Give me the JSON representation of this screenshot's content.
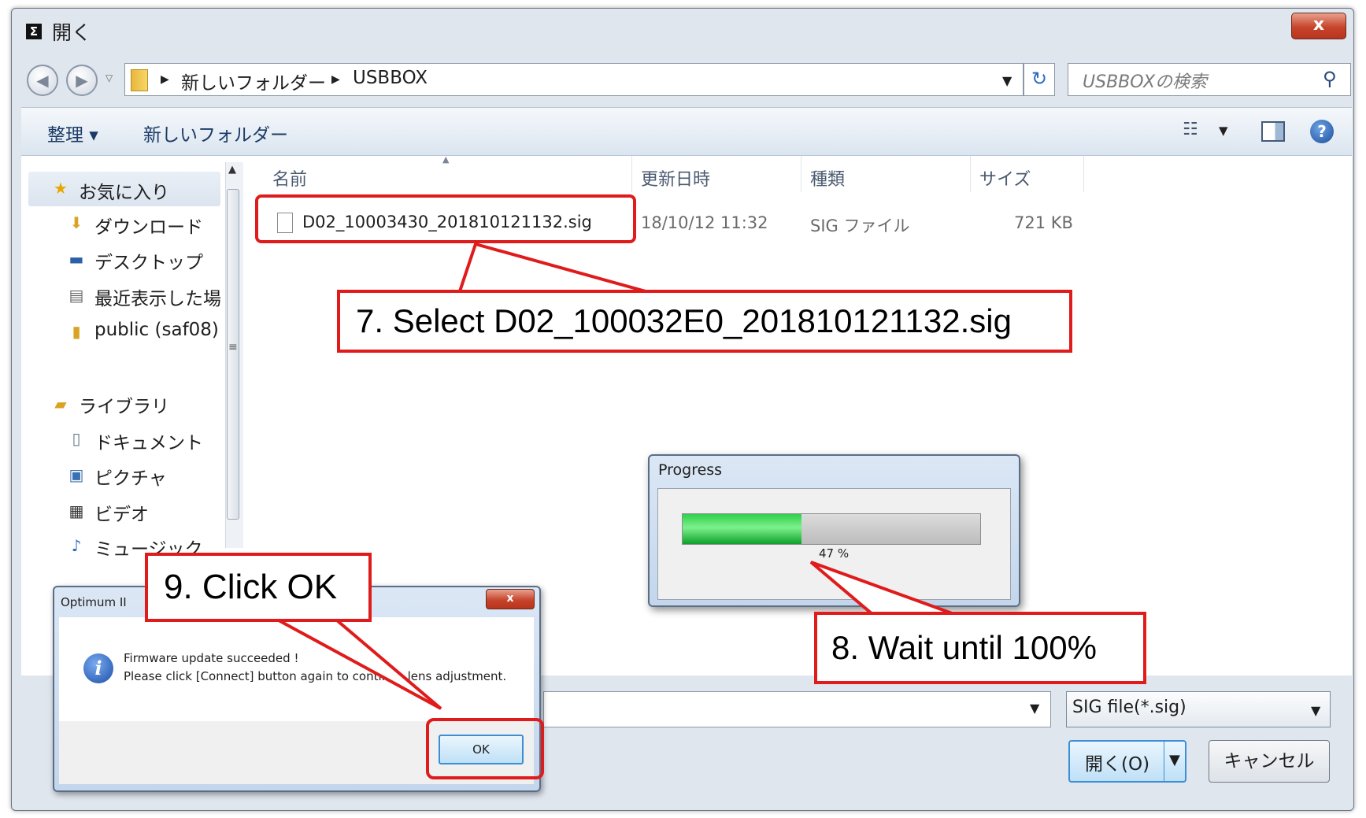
{
  "window": {
    "title": "開く",
    "close_label": "x"
  },
  "address": {
    "crumbs": [
      "新しいフォルダー",
      "USBBOX"
    ],
    "search_placeholder": "USBBOXの検索"
  },
  "toolbar": {
    "organize_label": "整理 ▾",
    "new_folder_label": "新しいフォルダー"
  },
  "sidebar": {
    "items": [
      {
        "label": "お気に入り",
        "icon": "star-icon"
      },
      {
        "label": "ダウンロード",
        "icon": "downloads-icon"
      },
      {
        "label": "デスクトップ",
        "icon": "desktop-icon"
      },
      {
        "label": "最近表示した場所",
        "icon": "recent-places-icon"
      },
      {
        "label": "public (saf08)",
        "icon": "network-folder-icon"
      },
      {
        "label": "ライブラリ",
        "icon": "library-icon"
      },
      {
        "label": "ドキュメント",
        "icon": "documents-icon"
      },
      {
        "label": "ピクチャ",
        "icon": "pictures-icon"
      },
      {
        "label": "ビデオ",
        "icon": "videos-icon"
      },
      {
        "label": "ミュージック",
        "icon": "music-icon"
      }
    ]
  },
  "file_list": {
    "columns": [
      "名前",
      "更新日時",
      "種類",
      "サイズ"
    ],
    "rows": [
      {
        "name": "D02_10003430_201810121132.sig",
        "date": "18/10/12 11:32",
        "type": "SIG ファイル",
        "size": "721 KB"
      }
    ]
  },
  "footer": {
    "filename_value": "",
    "filetype_value": "SIG file(*.sig)",
    "open_label": "開く(O)",
    "cancel_label": "キャンセル"
  },
  "progress": {
    "title": "Progress",
    "percent_label": "47 %",
    "fraction": 0.4
  },
  "message_box": {
    "title": "Optimum II",
    "line1": "Firmware update succeeded !",
    "line2": "Please click [Connect] button again to continue lens adjustment.",
    "ok_label": "OK",
    "close_label": "x"
  },
  "annotations": {
    "step7": "7. Select D02_100032E0_201810121132.sig",
    "step8": "8. Wait until 100%",
    "step9": "9. Click OK",
    "color": "#e01b1b"
  }
}
